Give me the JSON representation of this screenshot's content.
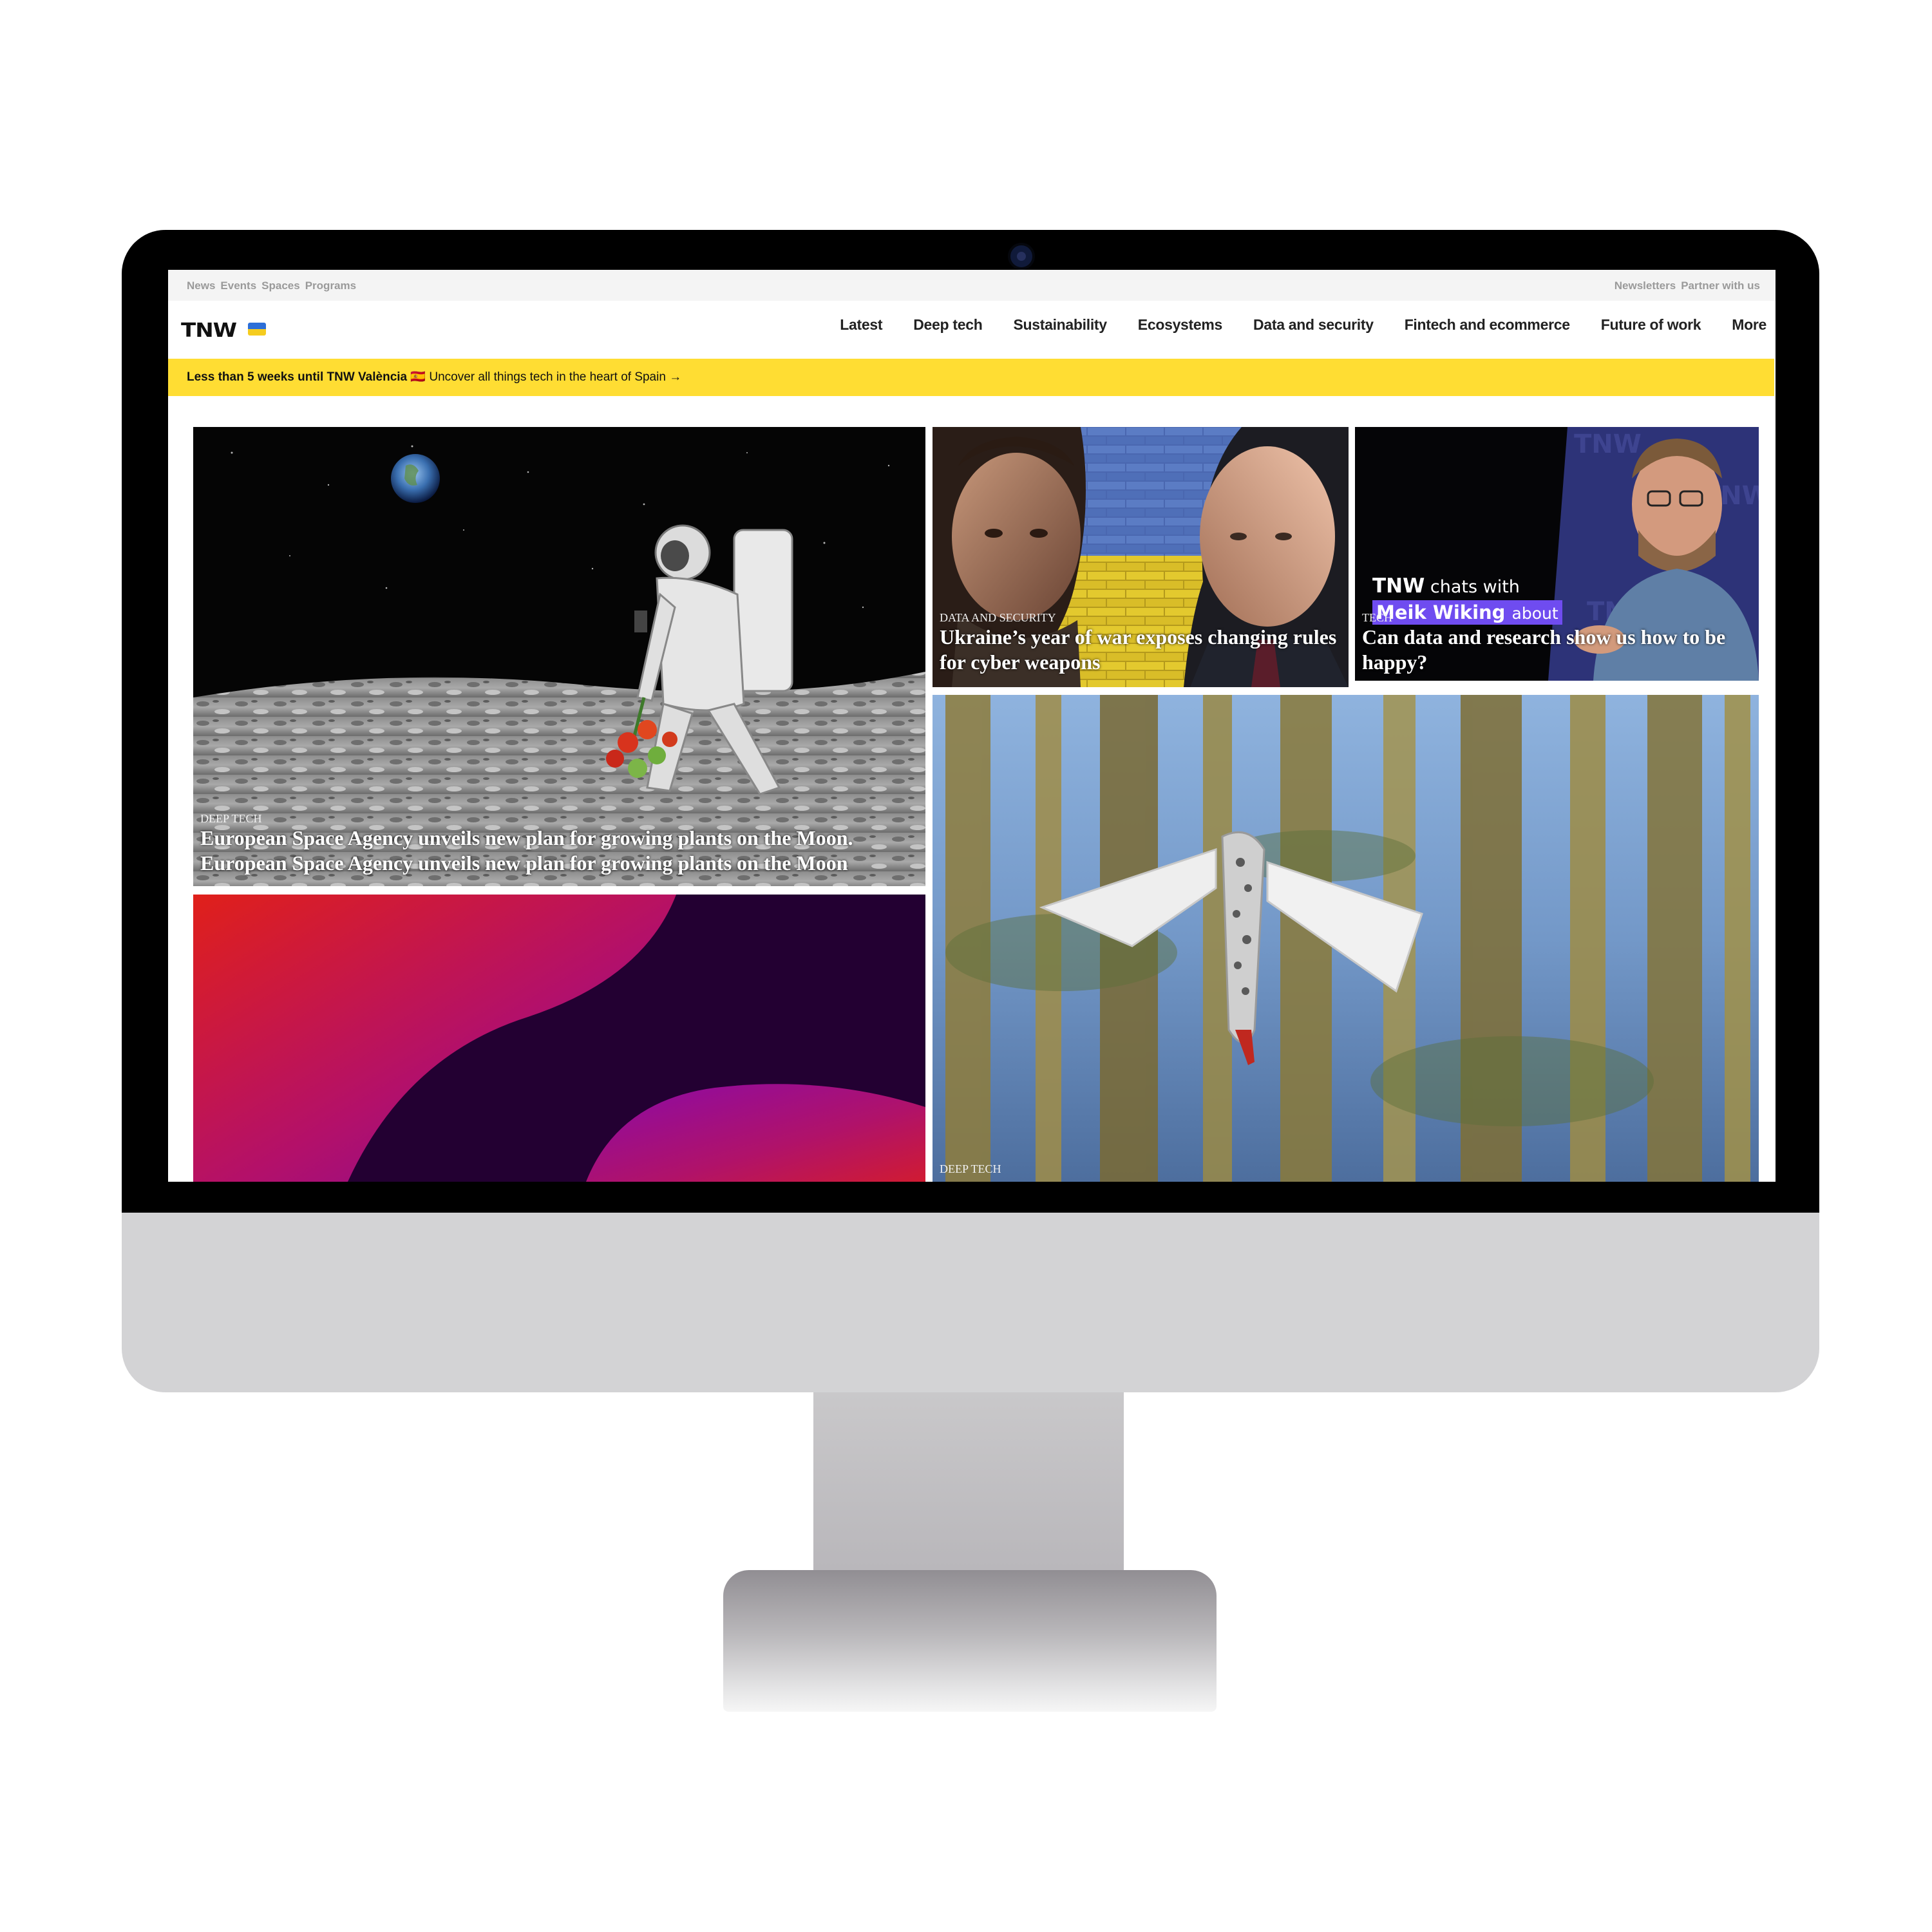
{
  "topbar": {
    "left_links": [
      "News",
      "Events",
      "Spaces",
      "Programs"
    ],
    "right_links": [
      "Newsletters",
      "Partner with us"
    ]
  },
  "header": {
    "logo": "TNW",
    "nav": [
      "Latest",
      "Deep tech",
      "Sustainability",
      "Ecosystems",
      "Data and security",
      "Fintech and ecommerce",
      "Future of work",
      "More"
    ]
  },
  "banner": {
    "bold": "Less than 5 weeks until TNW València",
    "emoji": "🇪🇸",
    "text": "Uncover all things tech in the heart of Spain →"
  },
  "articles": {
    "moon": {
      "category": "DEEP TECH",
      "title": "European Space Agency unveils new plan for growing plants on the Moon.",
      "title2": "European Space Agency unveils new plan for growing plants on the Moon"
    },
    "ukraine": {
      "category": "DATA AND SECURITY",
      "title": "Ukraine’s year of war exposes changing rules for cyber weapons"
    },
    "happy": {
      "category": "TECH",
      "title": "Can data and research show us how to be happy?",
      "overlay_line1_bold": "TNW",
      "overlay_line1": "chats with",
      "overlay_line2_bold": "Meik Wiking",
      "overlay_line2": "about"
    },
    "drone": {
      "category": "DEEP TECH"
    }
  },
  "colors": {
    "banner": "#ffdd33",
    "overlay_purple": "#6f4cf0"
  }
}
